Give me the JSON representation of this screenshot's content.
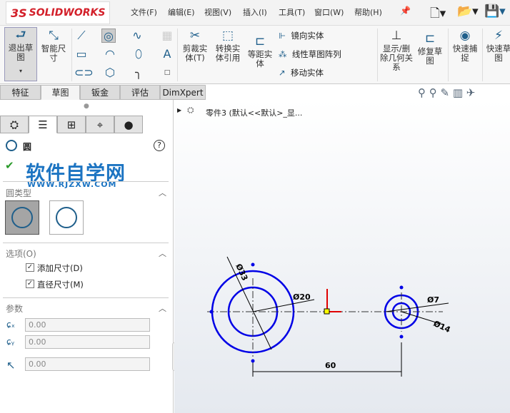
{
  "app": {
    "logo": "SOLIDWORKS"
  },
  "menu": [
    "文件(F)",
    "编辑(E)",
    "视图(V)",
    "插入(I)",
    "工具(T)",
    "窗口(W)",
    "帮助(H)"
  ],
  "ribbon": {
    "exit_sketch": "退出草图",
    "smart_dim": "智能尺寸",
    "trim": "剪裁实体(T)",
    "convert": "转换实体引用",
    "offset": "等距实体",
    "mirror": "镜向实体",
    "linear_pattern": "线性草图阵列",
    "move": "移动实体",
    "show_relations": "显示/删除几何关系",
    "repair": "修复草图",
    "quick_snap": "快速捕捉",
    "rapid_sketch": "快速草图"
  },
  "tabs": [
    "特征",
    "草图",
    "钣金",
    "评估",
    "DimXpert"
  ],
  "tree": {
    "label": "零件3 (默认<<默认>_显..."
  },
  "panel": {
    "title": "圆",
    "watermark": "软件自学网",
    "watermark_url": "WWW.RJZXW.COM",
    "circle_type_header": "圆类型",
    "options_header": "选项(O)",
    "add_dim": "添加尺寸(D)",
    "diameter_dim": "直径尺寸(M)",
    "params_header": "参数",
    "x": "0.00",
    "y": "0.00",
    "r": "0.00"
  },
  "drawing": {
    "d1": "Ø33",
    "d2": "Ø20",
    "d3": "Ø7",
    "d4": "Ø14",
    "dist": "60"
  },
  "colors": {
    "sketch": "#0000e6",
    "accent": "#1f5f8b",
    "origin": "#e00000"
  }
}
